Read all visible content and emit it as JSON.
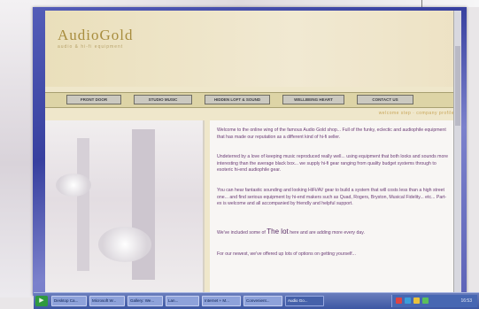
{
  "site": {
    "logo": "AudioGold",
    "tagline": "audio & hi-fi equipment"
  },
  "nav": {
    "items": [
      {
        "label": "FRONT DOOR"
      },
      {
        "label": "STUDIO MUSIC"
      },
      {
        "label": "HIDDEN LOFT & SOUND"
      },
      {
        "label": "WELLBEING HEART"
      },
      {
        "label": "CONTACT US"
      }
    ]
  },
  "breadcrumb": "welcome step · company profile",
  "content": {
    "p1": "Welcome to the online wing of the famous Audio Gold shop... Full of the funky, eclectic and audiophile equipment that has made our reputation as a different kind of hi-fi seller.",
    "p2": "Undeterred by a love of keeping music reproduced really well... using equipment that both looks and sounds more interesting than the average black box... we supply hi-fi gear ranging from quality budget systems through to esoteric hi-end audiophile gear.",
    "p3": "You can hear fantastic sounding and looking HiFi/AV gear to build a system that will costs less than a high street one... and find serious equipment by hi-end makers such as Quad, Rogers, Bryston, Musical Fidelity... etc... Part-ex is welcome and all accompanied by friendly and helpful support.",
    "p4_before": "We've included some of",
    "p4_emph": "The lot",
    "p4_after": "here and are adding more every day.",
    "p5": "For our newest, we've offered up lots of options on getting yourself..."
  },
  "taskbar": {
    "start_label": "▶",
    "tasks": [
      {
        "label": "Desktop Ca..."
      },
      {
        "label": "Microsoft W..."
      },
      {
        "label": "Gallery: We..."
      },
      {
        "label": "Lan..."
      },
      {
        "label": "Internet + M..."
      },
      {
        "label": "Convenient..."
      },
      {
        "label": "Audio Go...",
        "active": true
      }
    ],
    "clock": "16:53"
  }
}
